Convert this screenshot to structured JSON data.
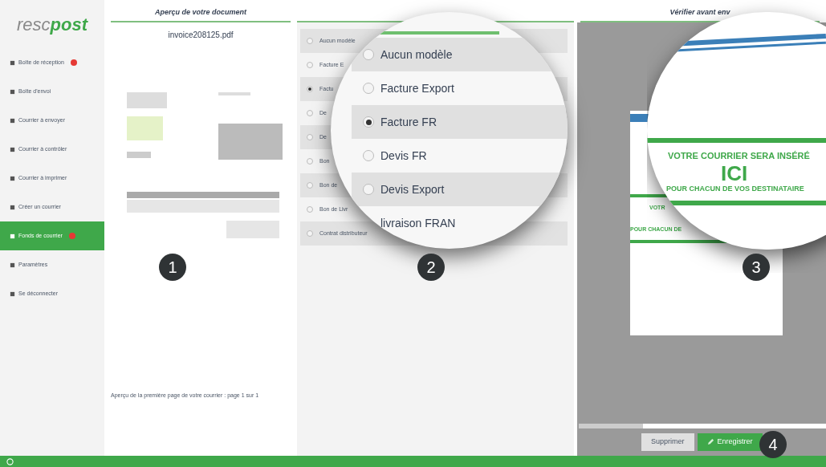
{
  "logo": {
    "left": "resc",
    "right": "post"
  },
  "sidebar": {
    "items": [
      {
        "label": "Boîte de réception",
        "selected": false,
        "badge": true
      },
      {
        "label": "Boîte d'envoi",
        "selected": false,
        "badge": false
      },
      {
        "label": "Courrier à envoyer",
        "selected": false,
        "badge": false
      },
      {
        "label": "Courrier à contrôler",
        "selected": false,
        "badge": false
      },
      {
        "label": "Courrier à imprimer",
        "selected": false,
        "badge": false
      },
      {
        "label": "Créer un courrier",
        "selected": false,
        "badge": false
      },
      {
        "label": "Fonds de courrier",
        "selected": true,
        "badge": true
      },
      {
        "label": "Paramètres",
        "selected": false,
        "badge": false
      },
      {
        "label": "Se déconnecter",
        "selected": false,
        "badge": false
      }
    ]
  },
  "headers": [
    "Aperçu de votre document",
    "Vérifier avant env"
  ],
  "preview": {
    "filename": "invoice208125.pdf",
    "caption": "Aperçu de la première page de votre courrier : page 1 sur 1"
  },
  "templates": {
    "items": [
      {
        "label": "Aucun modèle",
        "selected": false
      },
      {
        "label": "Facture E",
        "selected": false
      },
      {
        "label": "Factu",
        "selected": true
      },
      {
        "label": "De",
        "selected": false
      },
      {
        "label": "De",
        "selected": false
      },
      {
        "label": "Bon",
        "selected": false
      },
      {
        "label": "Bon de",
        "selected": false
      },
      {
        "label": "Bon de Livr",
        "selected": false
      },
      {
        "label": "Contrat distributeur",
        "selected": false
      }
    ]
  },
  "magnifier_templates": {
    "items": [
      {
        "label": "Aucun modèle",
        "selected": false
      },
      {
        "label": "Facture Export",
        "selected": false
      },
      {
        "label": "Facture FR",
        "selected": true
      },
      {
        "label": "Devis FR",
        "selected": false
      },
      {
        "label": "Devis Export",
        "selected": false
      },
      {
        "label": "livraison FRAN"
      }
    ]
  },
  "magnifier_letter": {
    "line1": "VOTRE COURRIER SERA INSÉRÉ",
    "big": "ICI",
    "line2": "POUR CHACUN DE VOS DESTINATAIRE"
  },
  "letter_preview": {
    "line1": "VOTR",
    "line2": "POUR CHACUN DE"
  },
  "step_markers": [
    "1",
    "2",
    "3",
    "4"
  ],
  "actions": {
    "delete": "Supprimer",
    "save": "Enregistrer"
  }
}
